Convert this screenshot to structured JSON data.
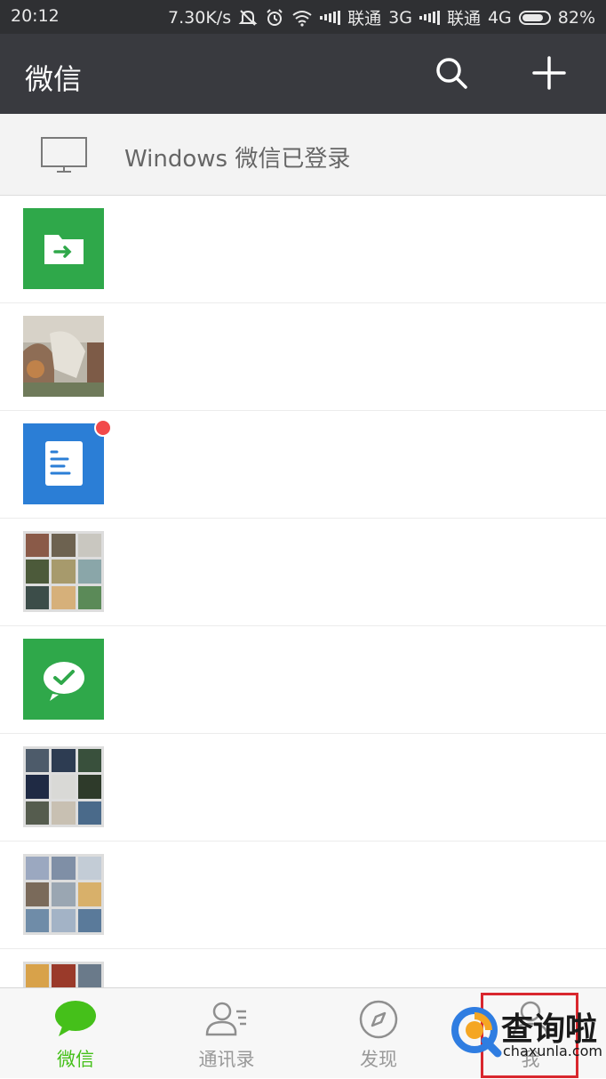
{
  "status_bar": {
    "time": "20:12",
    "speed": "7.30K/s",
    "carrier1": "联通",
    "net1": "3G",
    "carrier2": "联通",
    "net2": "4G",
    "battery": "82%",
    "battery_level": 0.82,
    "icons": [
      "mute-icon",
      "alarm-icon",
      "wifi-icon",
      "signal-icon",
      "battery-icon"
    ]
  },
  "app_bar": {
    "title": "微信",
    "actions": [
      "search-icon",
      "plus-icon"
    ]
  },
  "login_bar": {
    "text": "Windows 微信已登录",
    "icon": "monitor-icon"
  },
  "chats": [
    {
      "avatar": "file-transfer-icon",
      "color": "#2fa84a"
    },
    {
      "avatar": "photo"
    },
    {
      "avatar": "document-icon",
      "color": "#2b7ed6",
      "unread_dot": true
    },
    {
      "avatar": "group-grid"
    },
    {
      "avatar": "wechat-pay-icon",
      "color": "#2fa84a"
    },
    {
      "avatar": "group-grid"
    },
    {
      "avatar": "group-grid"
    },
    {
      "avatar": "group-grid"
    }
  ],
  "bottom_nav": {
    "items": [
      {
        "label": "微信",
        "icon": "chat-bubble-icon",
        "active": true
      },
      {
        "label": "通讯录",
        "icon": "contacts-icon",
        "active": false
      },
      {
        "label": "发现",
        "icon": "compass-icon",
        "active": false
      },
      {
        "label": "我",
        "icon": "profile-icon",
        "active": false
      }
    ]
  },
  "watermark": {
    "cn": "查询啦",
    "en": "chaxunla.com"
  },
  "colors": {
    "accent_green": "#45c01a",
    "appbar": "#393a3f",
    "highlight": "#d9272e"
  }
}
